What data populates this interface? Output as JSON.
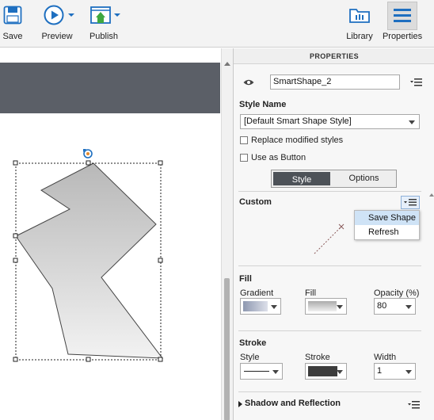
{
  "toolbar": {
    "save_label": "Save",
    "preview_label": "Preview",
    "publish_label": "Publish",
    "library_label": "Library",
    "properties_label": "Properties"
  },
  "properties": {
    "header": "PROPERTIES",
    "object_name": "SmartShape_2",
    "style_name_title": "Style Name",
    "style_name_value": "[Default Smart Shape Style]",
    "replace_modified_label": "Replace modified styles",
    "use_as_button_label": "Use as Button",
    "tabs": [
      {
        "label": "Style",
        "active": true
      },
      {
        "label": "Options",
        "active": false
      }
    ],
    "custom_title": "Custom",
    "custom_menu": [
      "Save Shape",
      "Refresh"
    ],
    "fill_section": {
      "title": "Fill",
      "gradient_label": "Gradient",
      "fill_label": "Fill",
      "opacity_label": "Opacity (%)",
      "opacity_value": "80"
    },
    "stroke_section": {
      "title": "Stroke",
      "style_label": "Style",
      "stroke_label": "Stroke",
      "width_label": "Width",
      "width_value": "1"
    },
    "shadow_title": "Shadow and Reflection"
  },
  "colors": {
    "stage_strip": "#5b5f67",
    "accent_blue": "#1e6fc0",
    "menu_highlight": "#cfe3f6"
  },
  "icons": [
    "save-icon",
    "preview-icon",
    "publish-icon",
    "library-icon",
    "properties-icon",
    "eye-icon",
    "rotate-handle-icon",
    "options-menu-icon"
  ]
}
